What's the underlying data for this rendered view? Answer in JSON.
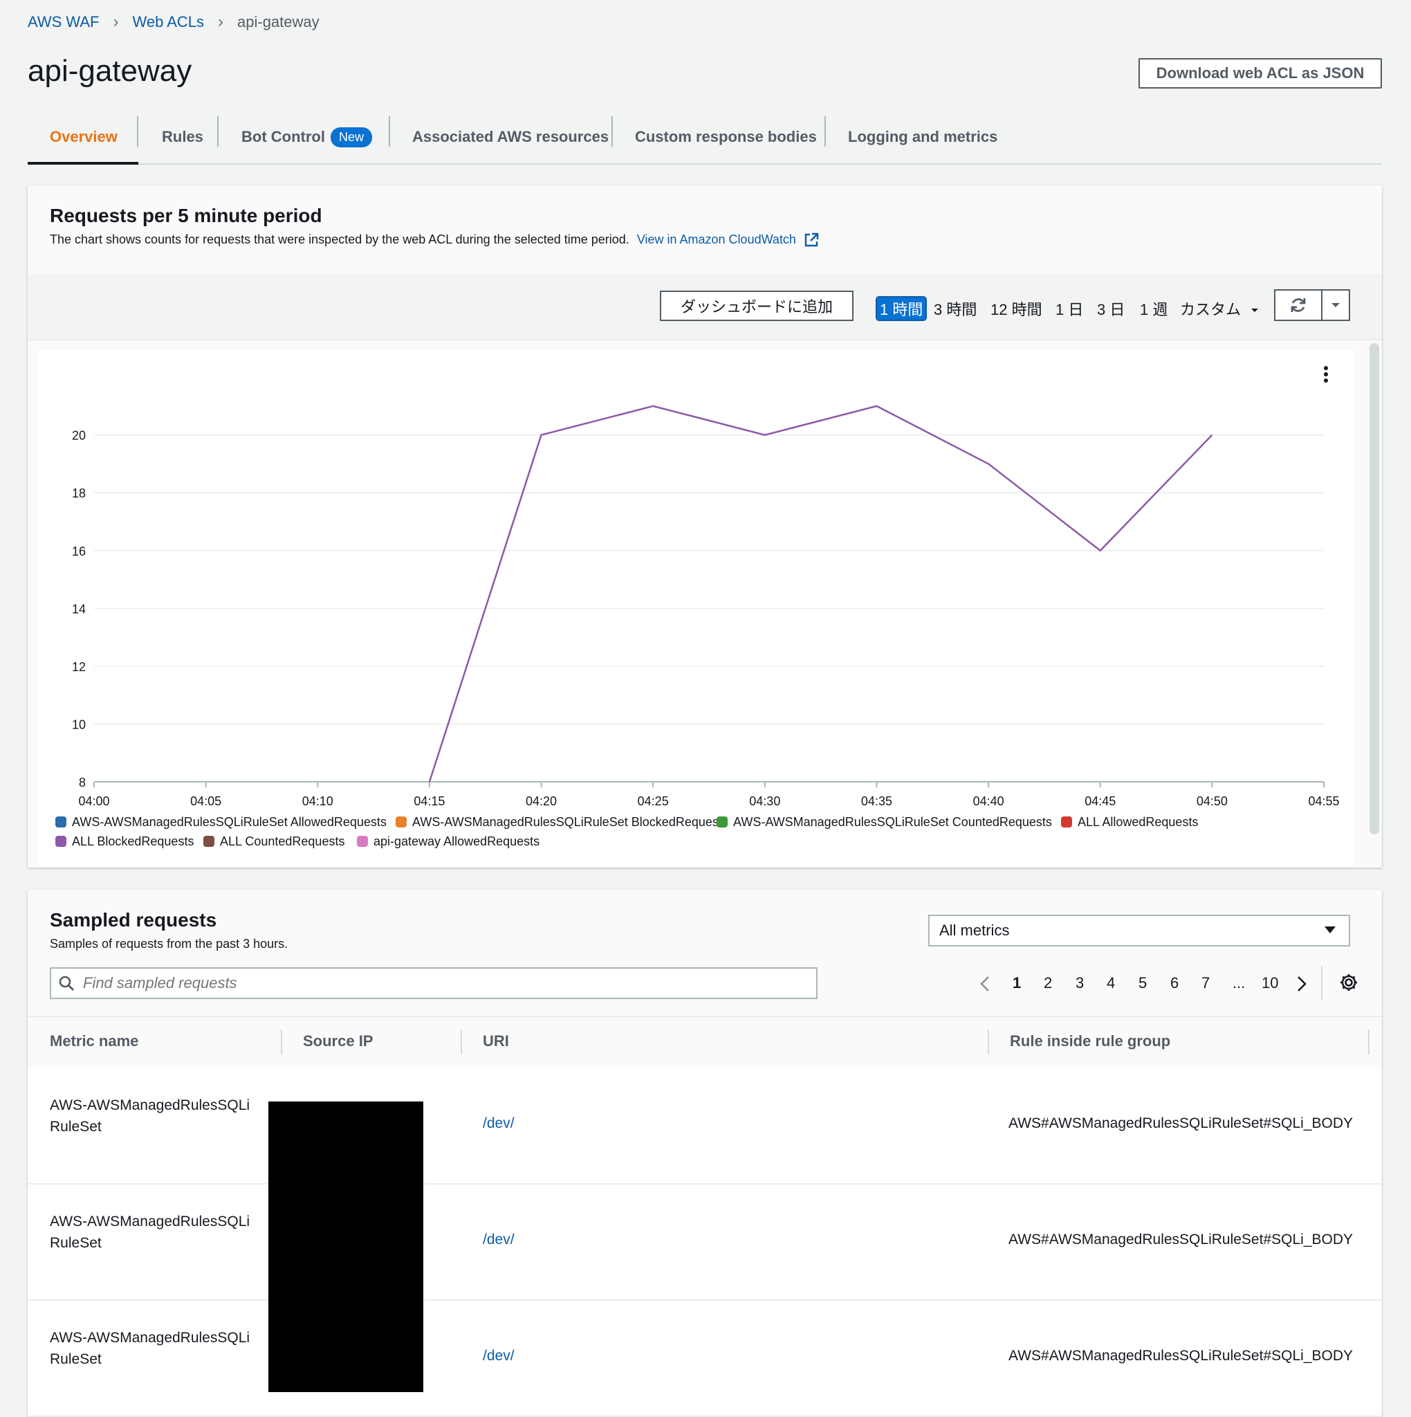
{
  "breadcrumb": {
    "items": [
      "AWS WAF",
      "Web ACLs",
      "api-gateway"
    ]
  },
  "page": {
    "title": "api-gateway",
    "download_label": "Download web ACL as JSON"
  },
  "tabs": {
    "overview": "Overview",
    "rules": "Rules",
    "bot_control": "Bot Control",
    "bot_badge": "New",
    "associated": "Associated AWS resources",
    "custom_response": "Custom response bodies",
    "logging": "Logging and metrics"
  },
  "chart_panel": {
    "title": "Requests per 5 minute period",
    "description": "The chart shows counts for requests that were inspected by the web ACL during the selected time period.",
    "cloudwatch_link": "View in Amazon CloudWatch",
    "add_dashboard": "ダッシュボードに追加",
    "ranges": [
      "1 時間",
      "3 時間",
      "12 時間",
      "1 日",
      "3 日",
      "1 週",
      "カスタム"
    ],
    "selected_range": "1 時間"
  },
  "chart_data": {
    "type": "line",
    "x": [
      "04:00",
      "04:05",
      "04:10",
      "04:15",
      "04:20",
      "04:25",
      "04:30",
      "04:35",
      "04:40",
      "04:45",
      "04:50",
      "04:55"
    ],
    "yticks": [
      8,
      10,
      12,
      14,
      16,
      18,
      20
    ],
    "ylim": [
      8,
      21.5
    ],
    "grid": true,
    "legend_position": "bottom",
    "series": [
      {
        "name": "ALL BlockedRequests",
        "color": "#8c5aa8",
        "points": [
          [
            "04:15",
            8
          ],
          [
            "04:20",
            20
          ],
          [
            "04:25",
            21
          ],
          [
            "04:30",
            20
          ],
          [
            "04:35",
            21
          ],
          [
            "04:40",
            19
          ],
          [
            "04:45",
            16
          ],
          [
            "04:50",
            20
          ]
        ]
      }
    ],
    "legend": [
      {
        "name": "AWS-AWSManagedRulesSQLiRuleSet AllowedRequests",
        "color": "#2c6cb0"
      },
      {
        "name": "AWS-AWSManagedRulesSQLiRuleSet BlockedRequests",
        "color": "#e8822b"
      },
      {
        "name": "AWS-AWSManagedRulesSQLiRuleSet CountedRequests",
        "color": "#3b9a35"
      },
      {
        "name": "ALL AllowedRequests",
        "color": "#d13b2e"
      },
      {
        "name": "ALL BlockedRequests",
        "color": "#8c5aa8"
      },
      {
        "name": "ALL CountedRequests",
        "color": "#7b4f42"
      },
      {
        "name": "api-gateway AllowedRequests",
        "color": "#d77ac1"
      }
    ]
  },
  "sampled": {
    "title": "Sampled requests",
    "description": "Samples of requests from the past 3 hours.",
    "metrics_select": "All metrics",
    "search_placeholder": "Find sampled requests",
    "pages": [
      "1",
      "2",
      "3",
      "4",
      "5",
      "6",
      "7",
      "...",
      "10"
    ],
    "columns": [
      "Metric name",
      "Source IP",
      "URI",
      "Rule inside rule group"
    ],
    "rows": [
      {
        "metric": "AWS-AWSManagedRulesSQLiRuleSet",
        "uri": "/dev/",
        "rule": "AWS#AWSManagedRulesSQLiRuleSet#SQLi_BODY"
      },
      {
        "metric": "AWS-AWSManagedRulesSQLiRuleSet",
        "uri": "/dev/",
        "rule": "AWS#AWSManagedRulesSQLiRuleSet#SQLi_BODY"
      },
      {
        "metric": "AWS-AWSManagedRulesSQLiRuleSet",
        "uri": "/dev/",
        "rule": "AWS#AWSManagedRulesSQLiRuleSet#SQLi_BODY"
      }
    ]
  }
}
